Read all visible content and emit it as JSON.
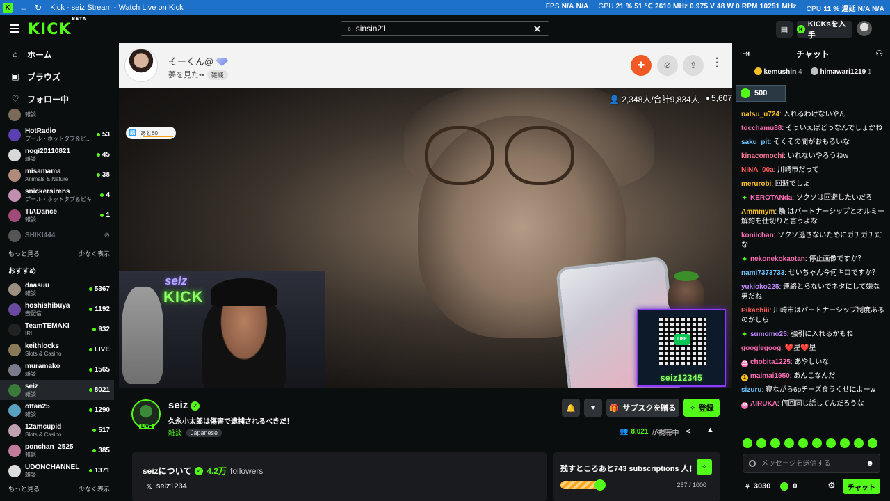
{
  "window": {
    "title": "Kick - seiz Stream - Watch Live on Kick",
    "perf": [
      {
        "label": "FPS",
        "v1": "N/A",
        "v2": "N/A"
      },
      {
        "label": "GPU",
        "v1": "21 %",
        "v2": "51 ℃ 2610 MHz 0.975 V 48 W 0 RPM 10251 MHz"
      },
      {
        "label": "CPU",
        "v1": "11 %",
        "v2": "遅延 N/A N/A"
      }
    ]
  },
  "header": {
    "logo": "KICK",
    "logo_sup": "BETA",
    "search_value": "sinsin21",
    "kicks_label": "KICKsを入手"
  },
  "sidebar": {
    "nav": [
      {
        "icon": "⌂",
        "label": "ホーム"
      },
      {
        "icon": "▣",
        "label": "ブラウズ"
      },
      {
        "icon": "♡",
        "label": "フォロー中"
      }
    ],
    "following": [
      {
        "name": "",
        "cat": "雑談",
        "viewers": "",
        "color": "#7a6a5a"
      },
      {
        "name": "HotRadio",
        "cat": "プール・ホットタブ＆ビ...",
        "viewers": "53",
        "color": "#5a3fb0"
      },
      {
        "name": "nogi20110821",
        "cat": "雑談",
        "viewers": "45",
        "color": "#d8d8d8"
      },
      {
        "name": "misamama",
        "cat": "Animals & Nature",
        "viewers": "38",
        "color": "#b08a7a"
      },
      {
        "name": "snickersirens",
        "cat": "プール・ホットタブ＆ビキニ",
        "viewers": "4",
        "color": "#c38fb0"
      },
      {
        "name": "TIADance",
        "cat": "雑談",
        "viewers": "1",
        "color": "#a04a7a"
      },
      {
        "name": "SHIKI444",
        "cat": "",
        "viewers": "",
        "color": "#555"
      }
    ],
    "show_more": "もっと見る",
    "show_less": "少なく表示",
    "rec_heading": "おすすめ",
    "recommended": [
      {
        "name": "daasuu",
        "cat": "雑談",
        "viewers": "5367",
        "color": "#9a8f80"
      },
      {
        "name": "hoshishibuya",
        "cat": "壺配信",
        "viewers": "1192",
        "color": "#6a4aa0"
      },
      {
        "name": "TeamTEMAKI",
        "cat": "IRL",
        "viewers": "932",
        "color": "#222"
      },
      {
        "name": "keithlocks",
        "cat": "Slots & Casino",
        "viewers": "LIVE",
        "color": "#8a7a5a"
      },
      {
        "name": "muramako",
        "cat": "雑談",
        "viewers": "1565",
        "color": "#7a7a8a"
      },
      {
        "name": "seiz",
        "cat": "雑談",
        "viewers": "8021",
        "color": "#3a7a3a"
      },
      {
        "name": "ottan25",
        "cat": "雑談",
        "viewers": "1290",
        "color": "#5aa0c0"
      },
      {
        "name": "12amcupid",
        "cat": "Slots & Casino",
        "viewers": "517",
        "color": "#c0a0b0"
      },
      {
        "name": "ponchan_2525",
        "cat": "雑談",
        "viewers": "385",
        "color": "#c07a9a"
      },
      {
        "name": "UDONCHANNEL",
        "cat": "雑談",
        "viewers": "1371",
        "color": "#dddddd"
      }
    ]
  },
  "stream_header": {
    "name": "そーくん@",
    "subtitle": "夢を見た••",
    "tag": "雑談"
  },
  "video": {
    "viewers": "2,348人/合計9,834人",
    "chat_count": "5,607",
    "badge_text": "あと60",
    "badge_tag": "顔",
    "pip_top": "seiz",
    "pip_bottom": "KICK",
    "qr_name": "seiz12345",
    "qr_logo": "LINE"
  },
  "stream_info": {
    "name": "seiz",
    "title": "久永小太郎は傷害で逮捕されるべきだ！",
    "category": "雑談",
    "language": "Japanese",
    "live": "LIVE",
    "sub_button": "サブスクを贈る",
    "follow_button": "登録",
    "watching_count": "8,021",
    "watching_label": "が視聴中"
  },
  "about": {
    "title": "seizについて",
    "followers_count": "4.2万",
    "followers_label": "followers",
    "x_handle": "seiz1234"
  },
  "goal": {
    "text": "残すところあと743 subscriptions 人！",
    "count": "257 / 1000",
    "progress": 0.257
  },
  "chat": {
    "title": "チャット",
    "pins": [
      {
        "user": "kemushin",
        "n": "4",
        "color": "#f6c026"
      },
      {
        "user": "himawari1219",
        "n": "1",
        "color": "#c0c0c0"
      }
    ],
    "pill_value": "500",
    "messages": [
      {
        "user": "natsu_u724",
        "color": "#f6c026",
        "text": "入れるわけないやん",
        "badge": ""
      },
      {
        "user": "tocchamu88",
        "color": "#ff6fb5",
        "text": "そういえばどうなんでしょかね",
        "badge": ""
      },
      {
        "user": "saku_pit",
        "color": "#6ec6ff",
        "text": "そくその間がおもろいな",
        "badge": ""
      },
      {
        "user": "kinacomochi",
        "color": "#ff7a9a",
        "text": "いれないやろうねw",
        "badge": ""
      },
      {
        "user": "NINA_00a",
        "color": "#ff5a5a",
        "text": "川崎市だって",
        "badge": ""
      },
      {
        "user": "merurobi",
        "color": "#f6c026",
        "text": "回避でしょ",
        "badge": ""
      },
      {
        "user": "KEROTANda",
        "color": "#ff6fb5",
        "text": "ソクソは回避したいだろ",
        "badge": "✦"
      },
      {
        "user": "Ammmym",
        "color": "#f6c026",
        "text": "🐘はパートナーシップとオルミー解約を仕切りと言うよな",
        "badge": ""
      },
      {
        "user": "koniichan",
        "color": "#ff6fb5",
        "text": "ソクソ逃さないためにガチガチだな",
        "badge": ""
      },
      {
        "user": "nekonekokaotan",
        "color": "#ff6fb5",
        "text": "停止画像ですか？",
        "badge": "✦"
      },
      {
        "user": "nami7373733",
        "color": "#6ec6ff",
        "text": "せいちゃん今何キロですか？",
        "badge": ""
      },
      {
        "user": "yukioko225",
        "color": "#c08aff",
        "text": "連絡とらないでネタにして嫌な男だね",
        "badge": ""
      },
      {
        "user": "Pikachiii",
        "color": "#ff5a5a",
        "text": "川崎市はパートナーシップ制度あるのかしら",
        "badge": ""
      },
      {
        "user": "sumomo25",
        "color": "#c08aff",
        "text": "強引に入れるかもね",
        "badge": "✦"
      },
      {
        "user": "googlegoog",
        "color": "#ff6fb5",
        "text": "❤️星❤️星",
        "badge": ""
      },
      {
        "user": "chobita1225",
        "color": "#ff6fb5",
        "text": "あやしいな",
        "badge": "28"
      },
      {
        "user": "maimai1950",
        "color": "#ff6fb5",
        "text": "あんこなんだ",
        "badge": "1"
      },
      {
        "user": "sizuru",
        "color": "#6ec6ff",
        "text": "寝ながら6pチーズ食うくせによーw",
        "badge": ""
      },
      {
        "user": "AIRUKA",
        "color": "#ff6fb5",
        "text": "何回同じ話してんだろうな",
        "badge": "38"
      }
    ],
    "input_placeholder": "メッセージを送信する",
    "points": "3030",
    "kicks": "0",
    "send_label": "チャット"
  }
}
